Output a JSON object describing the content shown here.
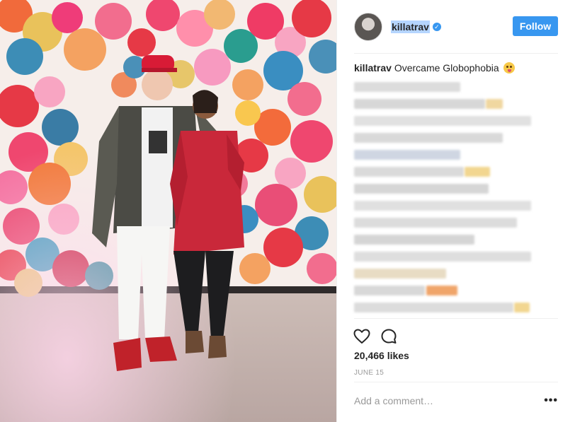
{
  "post": {
    "author": {
      "username": "killatrav",
      "verified": true,
      "avatar_icon": "user-avatar"
    },
    "follow_label": "Follow",
    "caption": {
      "username": "killatrav",
      "text": "Overcame Globophobia"
    },
    "likes": "20,466 likes",
    "date": "JUNE 15",
    "comment_placeholder": "Add a comment…",
    "more_label": "•••",
    "icons": {
      "like": "heart-icon",
      "comment": "comment-bubble-icon",
      "more": "more-options-icon",
      "verified": "verified-badge-icon"
    }
  },
  "colors": {
    "accent": "#3897f0",
    "text": "#262626",
    "muted": "#999999",
    "divider": "#efefef",
    "selection": "#b5d5ff"
  }
}
